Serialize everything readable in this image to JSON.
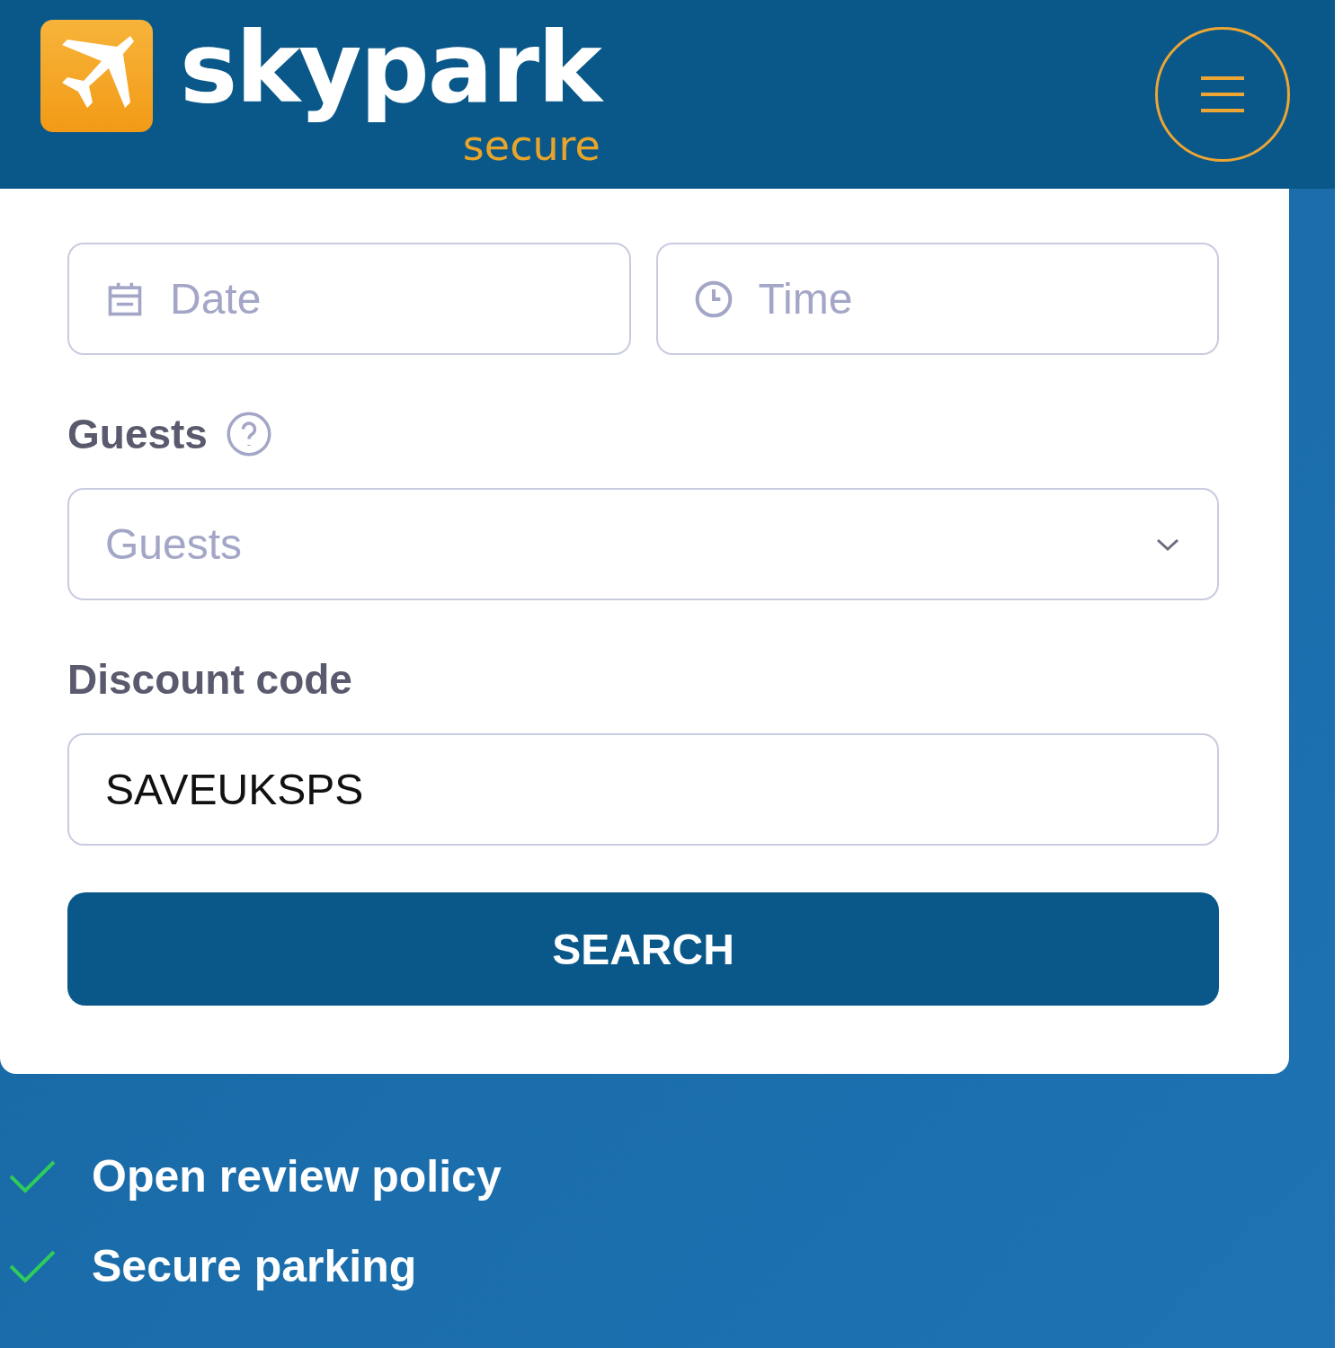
{
  "header": {
    "brand": "skypark",
    "tagline": "secure"
  },
  "form": {
    "exit_date": {
      "placeholder": "Date"
    },
    "exit_time": {
      "placeholder": "Time"
    },
    "guests": {
      "label": "Guests",
      "placeholder": "Guests"
    },
    "discount": {
      "label": "Discount code",
      "value": "SAVEUKSPS"
    },
    "search_button": "SEARCH"
  },
  "features": [
    "Open review policy",
    "Secure parking"
  ]
}
